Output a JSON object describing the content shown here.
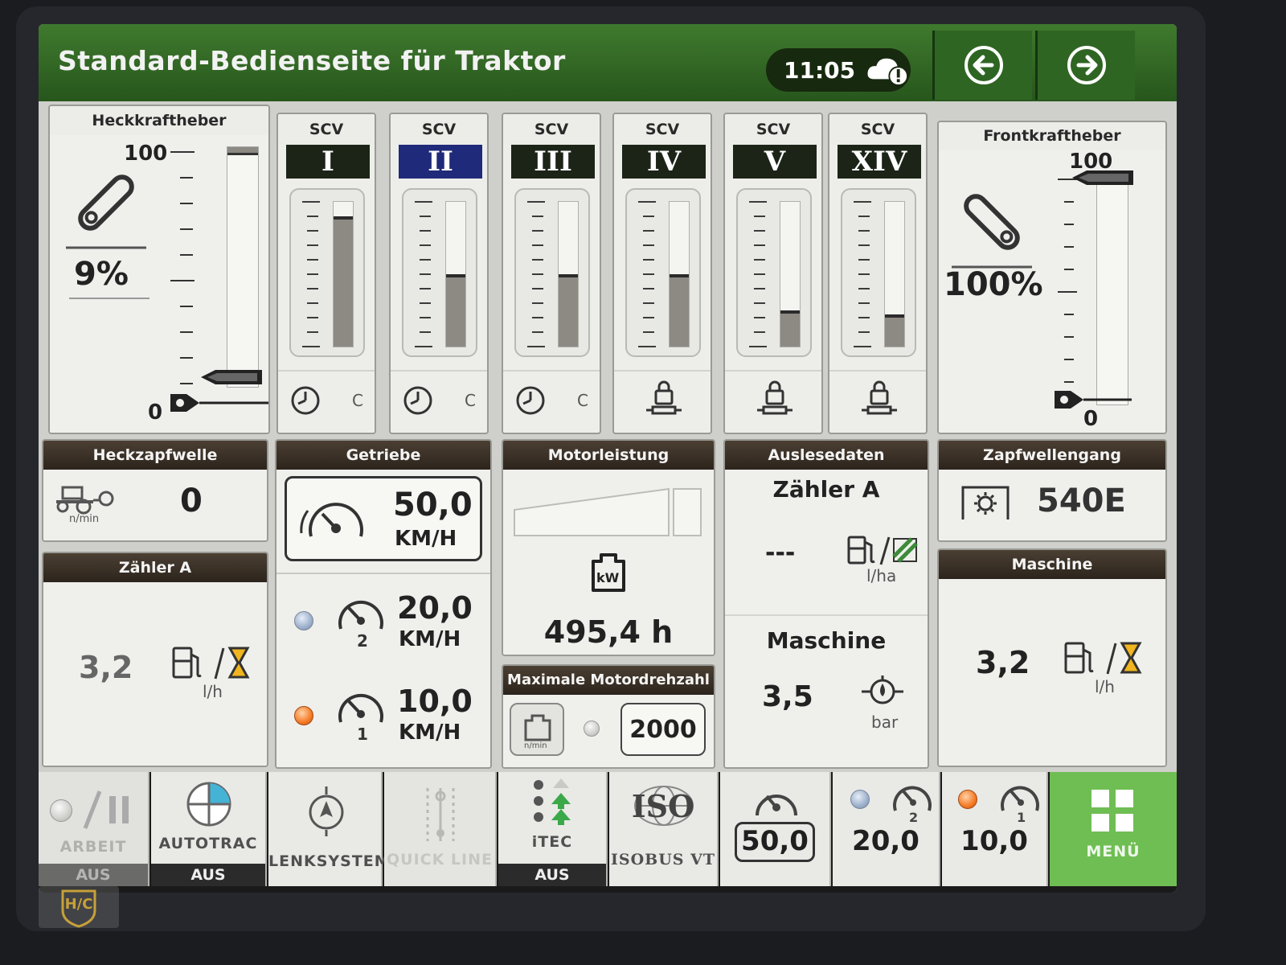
{
  "header": {
    "title": "Standard-Bedienseite für Traktor",
    "time": "11:05"
  },
  "rear_hitch": {
    "title": "Heckkraftheber",
    "percent": "9%",
    "scale_max": "100",
    "scale_min": "0",
    "level": 0.09
  },
  "scvs": [
    {
      "label": "SCV",
      "numeral": "I",
      "level": 0.9,
      "mode": "timer",
      "suffix": "C",
      "active": false
    },
    {
      "label": "SCV",
      "numeral": "II",
      "level": 0.5,
      "mode": "timer",
      "suffix": "C",
      "active": true
    },
    {
      "label": "SCV",
      "numeral": "III",
      "level": 0.5,
      "mode": "timer",
      "suffix": "C",
      "active": false
    },
    {
      "label": "SCV",
      "numeral": "IV",
      "level": 0.5,
      "mode": "lock",
      "suffix": "",
      "active": false
    },
    {
      "label": "SCV",
      "numeral": "V",
      "level": 0.25,
      "mode": "lock",
      "suffix": "",
      "active": false
    },
    {
      "label": "SCV",
      "numeral": "XIV",
      "level": 0.22,
      "mode": "lock",
      "suffix": "",
      "active": false
    }
  ],
  "front_hitch": {
    "title": "Frontkraftheber",
    "percent": "100%",
    "scale_max": "100",
    "scale_min": "0",
    "level": 1.0
  },
  "rear_pto": {
    "title": "Heckzapfwelle",
    "value": "0",
    "unit": "n/min"
  },
  "counter_a_left": {
    "title": "Zähler A",
    "value": "3,2",
    "unit": "l/h"
  },
  "transmission": {
    "title": "Getriebe",
    "current_speed": "50,0",
    "current_unit": "KM/H",
    "preset2_speed": "20,0",
    "preset2_unit": "KM/H",
    "preset1_speed": "10,0",
    "preset1_unit": "KM/H"
  },
  "engine_power": {
    "title": "Motorleistung",
    "hours": "495,4 h",
    "icon_label": "kW"
  },
  "max_rpm": {
    "title": "Maximale Motordrehzahl",
    "value": "2000",
    "icon_unit": "n/min"
  },
  "readout": {
    "title": "Auslesedaten",
    "counter_label": "Zähler A",
    "counter_value": "---",
    "counter_unit": "l/ha",
    "machine_label": "Maschine",
    "machine_value": "3,5",
    "machine_unit": "bar"
  },
  "pto_gear": {
    "title": "Zapfwellengang",
    "value": "540E"
  },
  "machine_right": {
    "title": "Maschine",
    "value": "3,2",
    "unit": "l/h"
  },
  "bottom_bar": {
    "work_label": "ARBEIT",
    "work_state": "AUS",
    "autotrac_label": "AUTOTRAC",
    "autotrac_state": "AUS",
    "steering_label": "LENKSYSTEM",
    "quickline_label": "QUICK LINE",
    "itec_label": "iTEC",
    "itec_state": "AUS",
    "isobus_logo": "ISO",
    "isobus_label": "ISOBUS VT",
    "speed_current": "50,0",
    "speed_preset2": "20,0",
    "speed_preset1": "10,0",
    "menu_label": "MENÜ"
  },
  "watermark": "H/C",
  "colors": {
    "header_green": "#2f6523",
    "panel_header": "#2c241c",
    "menu_green": "#6fbe53",
    "scv_active_blue": "#1f2a7a"
  }
}
